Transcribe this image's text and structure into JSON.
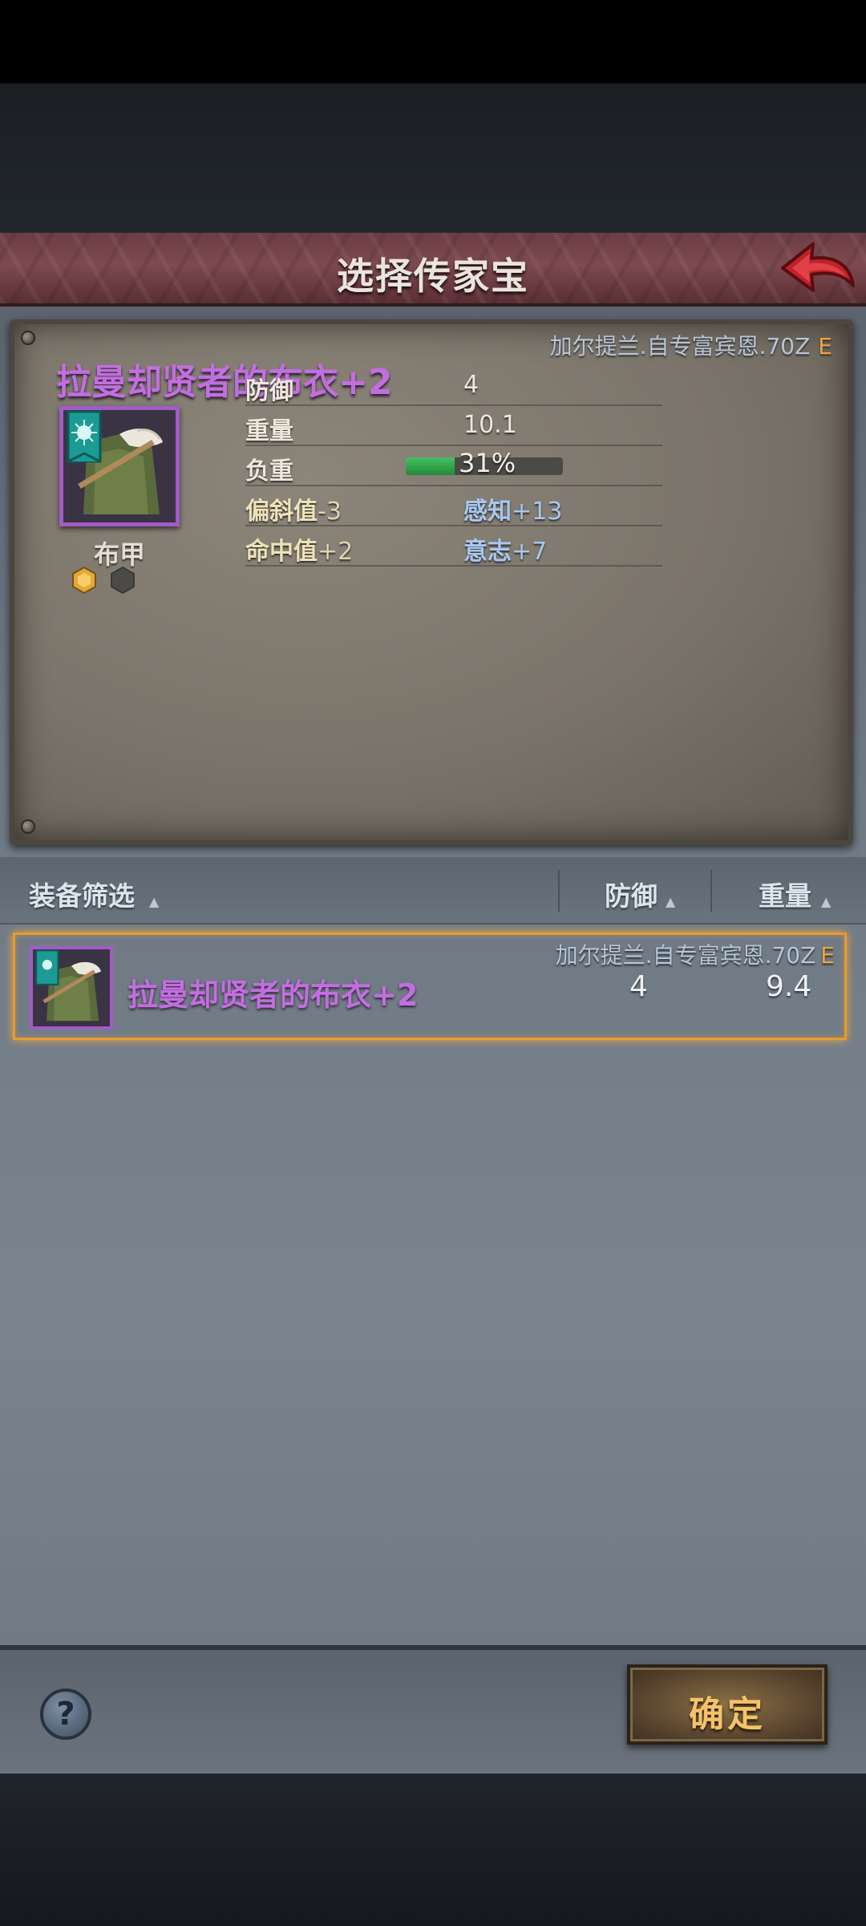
{
  "header": {
    "title": "选择传家宝",
    "back_icon": "back-arrow-icon"
  },
  "detail": {
    "owner": "加尔提兰.自专富宾恩.70Z",
    "grade": "E",
    "name": "拉曼却贤者的布衣+2",
    "type": "布甲",
    "sockets": [
      {
        "icon": "gem-socket-filled-icon",
        "color": "#e3a83a"
      },
      {
        "icon": "gem-socket-empty-icon",
        "color": "#4b4a48"
      }
    ],
    "stats": {
      "defense_label": "防御",
      "defense_value": "4",
      "weight_label": "重量",
      "weight_value": "10.1",
      "load_label": "负重",
      "load_text": "31%",
      "load_fraction": 0.31
    },
    "mods": {
      "deflect_label": "偏斜值",
      "deflect_value": "-3",
      "perception_label": "感知",
      "perception_value": "+13",
      "accuracy_label": "命中值",
      "accuracy_value": "+2",
      "will_label": "意志",
      "will_value": "+7"
    }
  },
  "filter": {
    "equipment_filter_label": "装备筛选",
    "defense_label": "防御",
    "weight_label": "重量"
  },
  "list": [
    {
      "owner": "加尔提兰.自专富宾恩.70Z",
      "grade": "E",
      "name": "拉曼却贤者的布衣+2",
      "defense": "4",
      "weight": "9.4"
    }
  ],
  "footer": {
    "help_label": "?",
    "confirm_label": "确定"
  },
  "colors": {
    "rarity_purple": "#c36ee0",
    "selection_orange": "#e99a2a",
    "grade_orange": "#f0a43a"
  }
}
